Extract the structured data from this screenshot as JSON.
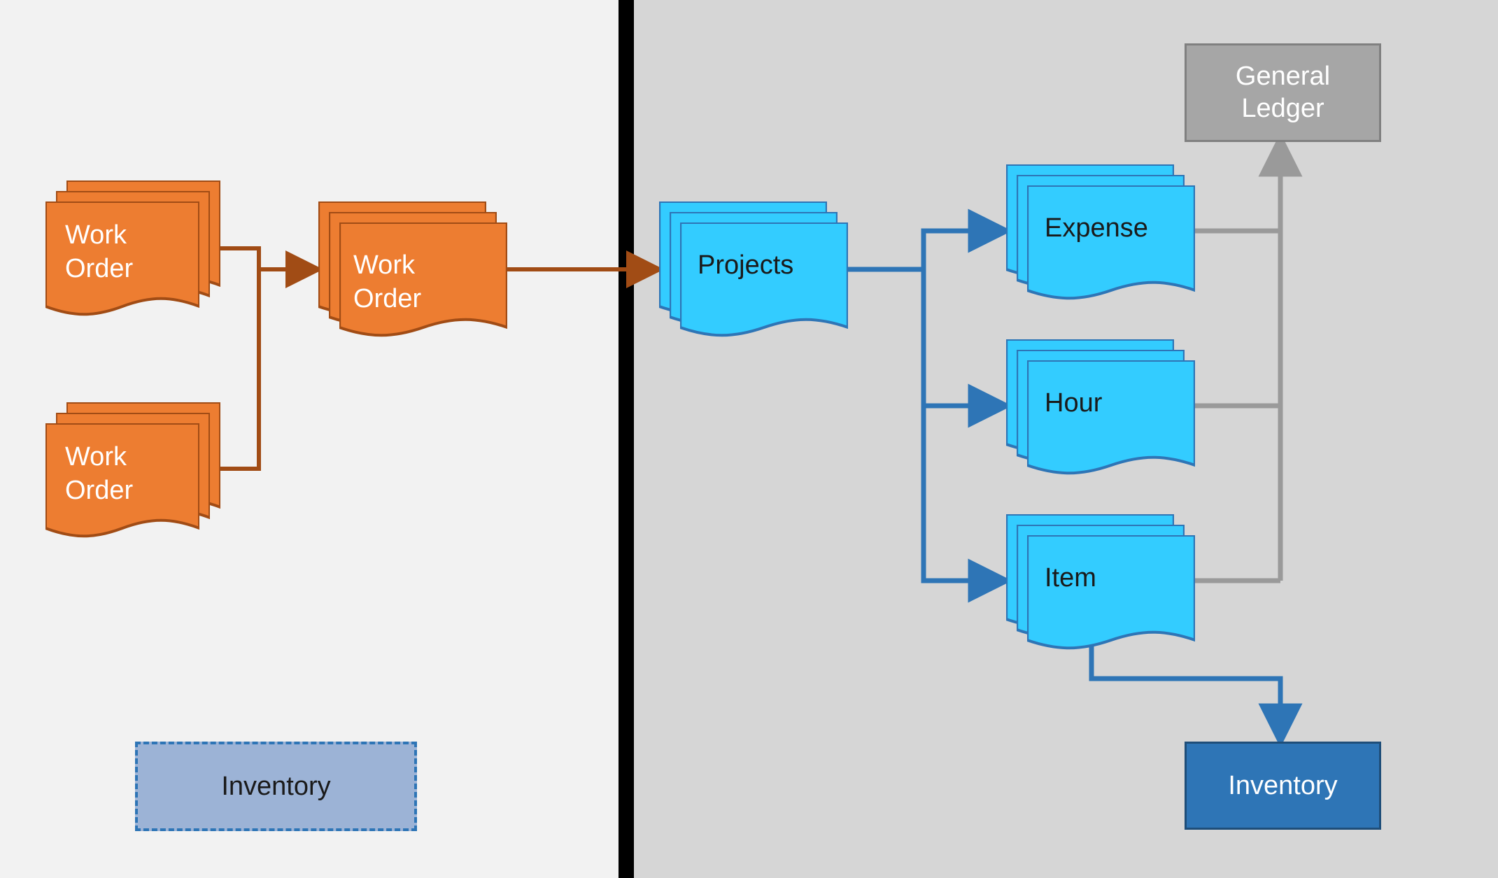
{
  "nodes": {
    "work_order_1": "Work\nOrder",
    "work_order_2": "Work\nOrder",
    "work_order_main": "Work Order",
    "projects": "Projects",
    "expense": "Expense",
    "hour": "Hour",
    "item": "Item",
    "general_ledger": "General\nLedger",
    "inventory_left": "Inventory",
    "inventory_right": "Inventory"
  },
  "colors": {
    "orange_fill": "#ed7d31",
    "orange_stroke": "#a14c15",
    "cyan_fill": "#33ccff",
    "cyan_stroke": "#2e75b6",
    "blue_fill": "#2e75b6",
    "blue_light": "#9cb3d6",
    "gray_fill": "#a6a6a6",
    "gray_stroke": "#808080",
    "text_light": "#ffffff",
    "text_dark": "#1a1a1a"
  },
  "layout": {
    "left_bg": "#f2f2f2",
    "right_bg": "#d6d6d6"
  },
  "diagram_type": "flow",
  "flows": [
    "work_order_1 -> work_order_main",
    "work_order_2 -> work_order_main",
    "work_order_main -> projects",
    "projects -> expense",
    "projects -> hour",
    "projects -> item",
    "expense -> general_ledger",
    "hour -> general_ledger",
    "item -> general_ledger",
    "item -> inventory_right"
  ]
}
